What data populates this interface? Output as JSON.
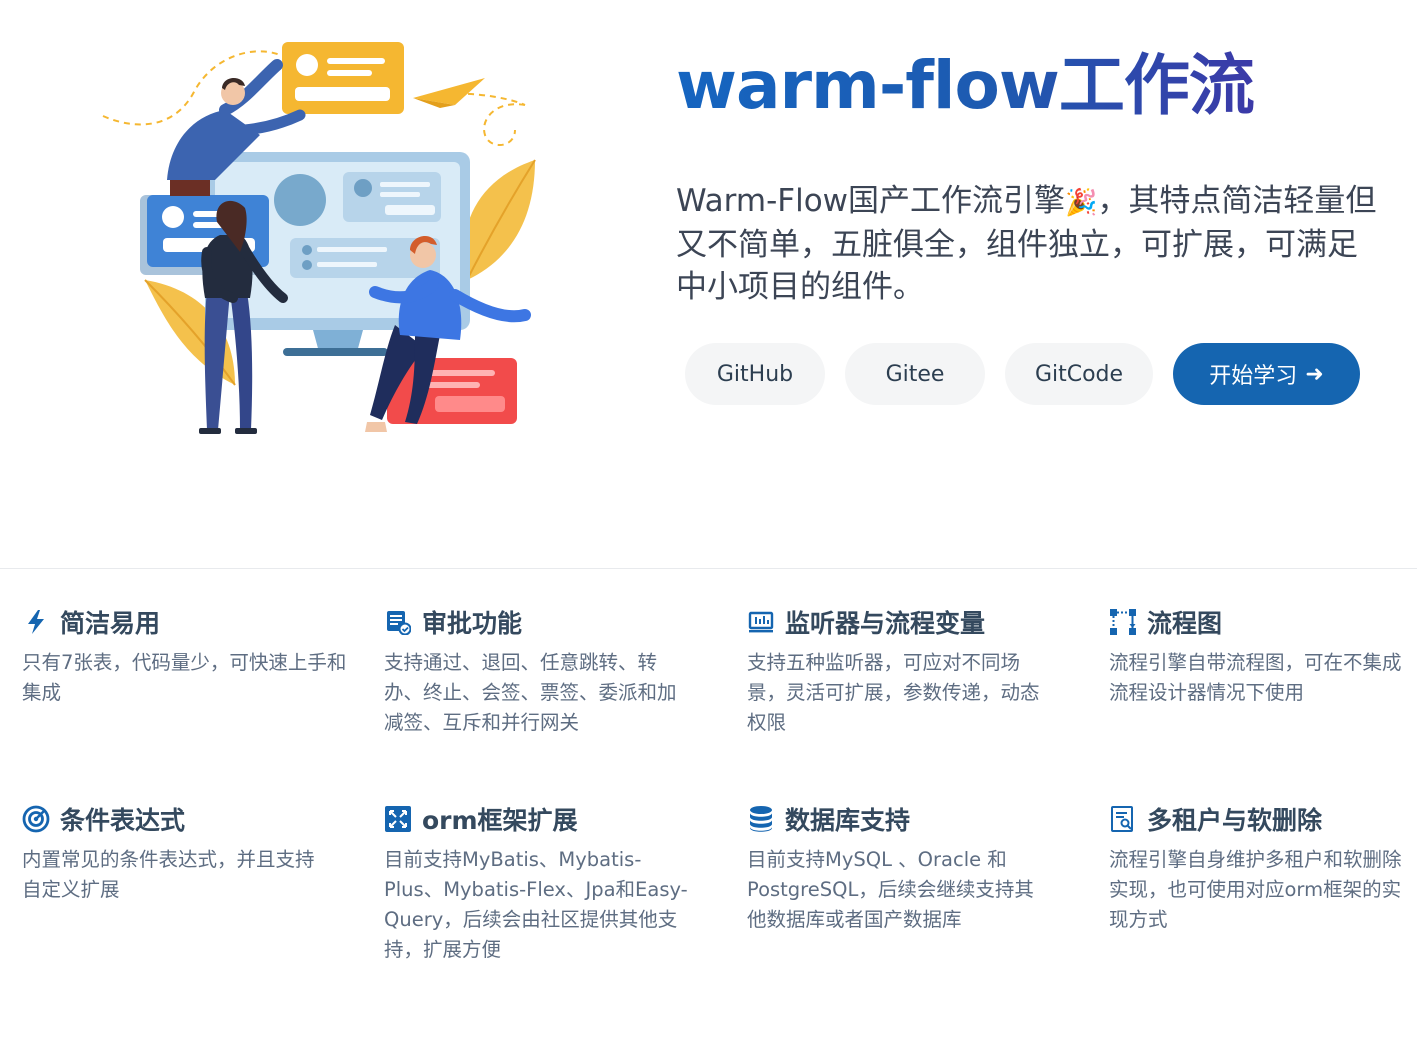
{
  "hero": {
    "title": "warm-flow工作流",
    "tagline_before": "Warm-Flow国产工作流引擎",
    "tagline_emoji": "🎉",
    "tagline_after": "，其特点简洁轻量但又不简单，五脏俱全，组件独立，可扩展，可满足中小项目的组件。",
    "buttons": {
      "github": "GitHub",
      "gitee": "Gitee",
      "gitcode": "GitCode",
      "start": "开始学习",
      "start_arrow": "➜"
    }
  },
  "features": [
    {
      "icon": "lightning-icon",
      "title": "简洁易用",
      "desc": "只有7张表，代码量少，可快速上手和集成"
    },
    {
      "icon": "approval-doc-icon",
      "title": "审批功能",
      "desc": "支持通过、退回、任意跳转、转办、终止、会签、票签、委派和加减签、互斥和并行网关"
    },
    {
      "icon": "monitor-icon",
      "title": "监听器与流程变量",
      "desc": "支持五种监听器，可应对不同场景，灵活可扩展，参数传递，动态权限"
    },
    {
      "icon": "flowchart-icon",
      "title": "流程图",
      "desc": "流程引擎自带流程图，可在不集成流程设计器情况下使用"
    },
    {
      "icon": "condition-icon",
      "title": "条件表达式",
      "desc": "内置常见的条件表达式，并且支持自定义扩展"
    },
    {
      "icon": "expand-icon",
      "title": "orm框架扩展",
      "desc": "目前支持MyBatis、Mybatis-Plus、Mybatis-Flex、Jpa和Easy-Query，后续会由社区提供其他支持，扩展方便"
    },
    {
      "icon": "database-icon",
      "title": "数据库支持",
      "desc": "目前支持MySQL 、Oracle 和PostgreSQL，后续会继续支持其他数据库或者国产数据库"
    },
    {
      "icon": "tenant-doc-icon",
      "title": "多租户与软删除",
      "desc": "流程引擎自身维护多租户和软删除实现，也可使用对应orm框架的实现方式"
    }
  ],
  "colors": {
    "accent": "#1565b0",
    "title_gradient_end": "#4a2fa0",
    "feature_title": "#34495e",
    "feature_desc": "#5e6d82"
  }
}
